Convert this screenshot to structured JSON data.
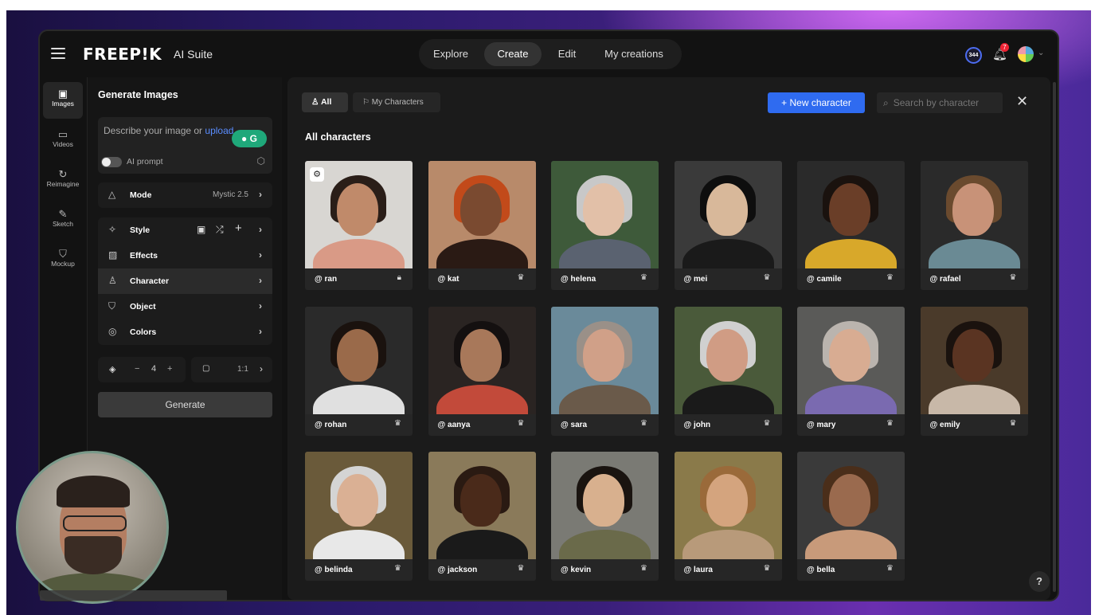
{
  "app": {
    "logo": "FREEP!K",
    "suite": "AI Suite"
  },
  "nav": {
    "tabs": [
      {
        "label": "Explore",
        "active": false
      },
      {
        "label": "Create",
        "active": true
      },
      {
        "label": "Edit",
        "active": false
      },
      {
        "label": "My creations",
        "active": false
      }
    ]
  },
  "header": {
    "credits": "344",
    "notifications": "7"
  },
  "rail": [
    {
      "label": "Images",
      "icon": "images-icon",
      "active": true
    },
    {
      "label": "Videos",
      "icon": "videos-icon",
      "active": false
    },
    {
      "label": "Reimagine",
      "icon": "reimagine-icon",
      "active": false
    },
    {
      "label": "Sketch",
      "icon": "sketch-icon",
      "active": false
    },
    {
      "label": "Mockup",
      "icon": "mockup-icon",
      "active": false
    }
  ],
  "panel": {
    "title": "Generate Images",
    "prompt_placeholder": "Describe your image or",
    "prompt_upload": "upload",
    "ai_prompt": "AI prompt",
    "mode_label": "Mode",
    "mode_value": "Mystic 2.5",
    "style_label": "Style",
    "effects_label": "Effects",
    "character_label": "Character",
    "object_label": "Object",
    "colors_label": "Colors",
    "quantity_minus": "−",
    "quantity": "4",
    "quantity_plus": "+",
    "ratio": "1:1",
    "generate": "Generate"
  },
  "main": {
    "filter_all": "All",
    "filter_my": "My Characters",
    "new_character": "+ New character",
    "search_placeholder": "Search by character",
    "section_title": "All characters",
    "help": "?"
  },
  "characters": [
    {
      "name": "@ ran",
      "badge": "lock-icon",
      "skin": "#c08a6a",
      "hair": "#2a1e18",
      "bg": "#d8d6d2",
      "shirt": "#d99a86"
    },
    {
      "name": "@ kat",
      "badge": "crown-icon",
      "skin": "#7a4a30",
      "hair": "#c24a1a",
      "bg": "#b88a6a",
      "shirt": "#2a1a14"
    },
    {
      "name": "@ helena",
      "badge": "crown-icon",
      "skin": "#e2c0a8",
      "hair": "#c8c8c8",
      "bg": "#3e5a3a",
      "shirt": "#5a6270"
    },
    {
      "name": "@ mei",
      "badge": "crown-icon",
      "skin": "#d8b89a",
      "hair": "#0e0e0e",
      "bg": "#3a3a3a",
      "shirt": "#1a1a1a"
    },
    {
      "name": "@ camile",
      "badge": "crown-icon",
      "skin": "#6a3e28",
      "hair": "#1a120e",
      "bg": "#2a2a2a",
      "shirt": "#d8a82a"
    },
    {
      "name": "@ rafael",
      "badge": "crown-icon",
      "skin": "#c89278",
      "hair": "#6a4a2e",
      "bg": "#2a2a2a",
      "shirt": "#6a8a94"
    },
    {
      "name": "@ rohan",
      "badge": "crown-icon",
      "skin": "#9a6a4a",
      "hair": "#1a120e",
      "bg": "#2a2a2a",
      "shirt": "#e0e0e0"
    },
    {
      "name": "@ aanya",
      "badge": "crown-icon",
      "skin": "#a8785a",
      "hair": "#141010",
      "bg": "#2a2422",
      "shirt": "#c24a3a"
    },
    {
      "name": "@ sara",
      "badge": "crown-icon",
      "skin": "#d0a088",
      "hair": "#9a9088",
      "bg": "#6a8a9a",
      "shirt": "#6a5a4a"
    },
    {
      "name": "@ john",
      "badge": "crown-icon",
      "skin": "#d09c84",
      "hair": "#d0d0d0",
      "bg": "#4a5a3a",
      "shirt": "#1a1a1a"
    },
    {
      "name": "@ mary",
      "badge": "crown-icon",
      "skin": "#d8ac92",
      "hair": "#bab4ae",
      "bg": "#5a5a58",
      "shirt": "#7a6ab0"
    },
    {
      "name": "@ emily",
      "badge": "crown-icon",
      "skin": "#5a3422",
      "hair": "#1a120e",
      "bg": "#4a3a2a",
      "shirt": "#c8b8a8"
    },
    {
      "name": "@ belinda",
      "badge": "crown-icon",
      "skin": "#dab094",
      "hair": "#d4d4d4",
      "bg": "#6a5a3a",
      "shirt": "#e8e8e8"
    },
    {
      "name": "@ jackson",
      "badge": "crown-icon",
      "skin": "#4a2a1a",
      "hair": "#2a1a12",
      "bg": "#8a7a5a",
      "shirt": "#1a1a1a"
    },
    {
      "name": "@ kevin",
      "badge": "crown-icon",
      "skin": "#d8b08e",
      "hair": "#1a1410",
      "bg": "#7a7a74",
      "shirt": "#6a6a4a"
    },
    {
      "name": "@ laura",
      "badge": "crown-icon",
      "skin": "#d4a47e",
      "hair": "#9a6a3a",
      "bg": "#8a7a4a",
      "shirt": "#b89a7a"
    },
    {
      "name": "@ bella",
      "badge": "crown-icon",
      "skin": "#9a6a4e",
      "hair": "#4a2e1a",
      "bg": "#3a3a3a",
      "shirt": "#c89a7a"
    }
  ],
  "colors": {
    "accent": "#2f6bf0",
    "panel": "#151515",
    "main": "#1b1b1b"
  }
}
